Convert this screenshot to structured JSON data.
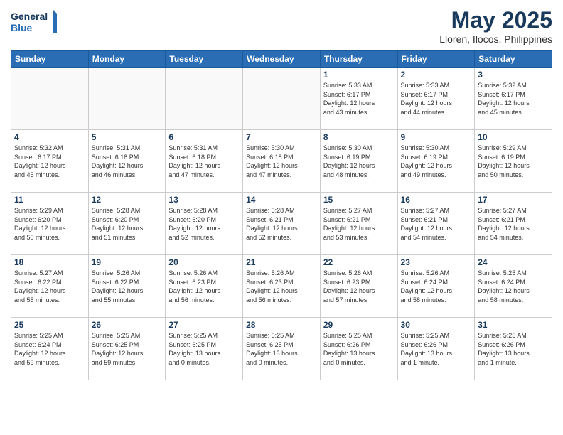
{
  "header": {
    "logo_line1": "General",
    "logo_line2": "Blue",
    "month": "May 2025",
    "location": "Lloren, Ilocos, Philippines"
  },
  "weekdays": [
    "Sunday",
    "Monday",
    "Tuesday",
    "Wednesday",
    "Thursday",
    "Friday",
    "Saturday"
  ],
  "weeks": [
    [
      {
        "day": "",
        "info": ""
      },
      {
        "day": "",
        "info": ""
      },
      {
        "day": "",
        "info": ""
      },
      {
        "day": "",
        "info": ""
      },
      {
        "day": "1",
        "info": "Sunrise: 5:33 AM\nSunset: 6:17 PM\nDaylight: 12 hours\nand 43 minutes."
      },
      {
        "day": "2",
        "info": "Sunrise: 5:33 AM\nSunset: 6:17 PM\nDaylight: 12 hours\nand 44 minutes."
      },
      {
        "day": "3",
        "info": "Sunrise: 5:32 AM\nSunset: 6:17 PM\nDaylight: 12 hours\nand 45 minutes."
      }
    ],
    [
      {
        "day": "4",
        "info": "Sunrise: 5:32 AM\nSunset: 6:17 PM\nDaylight: 12 hours\nand 45 minutes."
      },
      {
        "day": "5",
        "info": "Sunrise: 5:31 AM\nSunset: 6:18 PM\nDaylight: 12 hours\nand 46 minutes."
      },
      {
        "day": "6",
        "info": "Sunrise: 5:31 AM\nSunset: 6:18 PM\nDaylight: 12 hours\nand 47 minutes."
      },
      {
        "day": "7",
        "info": "Sunrise: 5:30 AM\nSunset: 6:18 PM\nDaylight: 12 hours\nand 47 minutes."
      },
      {
        "day": "8",
        "info": "Sunrise: 5:30 AM\nSunset: 6:19 PM\nDaylight: 12 hours\nand 48 minutes."
      },
      {
        "day": "9",
        "info": "Sunrise: 5:30 AM\nSunset: 6:19 PM\nDaylight: 12 hours\nand 49 minutes."
      },
      {
        "day": "10",
        "info": "Sunrise: 5:29 AM\nSunset: 6:19 PM\nDaylight: 12 hours\nand 50 minutes."
      }
    ],
    [
      {
        "day": "11",
        "info": "Sunrise: 5:29 AM\nSunset: 6:20 PM\nDaylight: 12 hours\nand 50 minutes."
      },
      {
        "day": "12",
        "info": "Sunrise: 5:28 AM\nSunset: 6:20 PM\nDaylight: 12 hours\nand 51 minutes."
      },
      {
        "day": "13",
        "info": "Sunrise: 5:28 AM\nSunset: 6:20 PM\nDaylight: 12 hours\nand 52 minutes."
      },
      {
        "day": "14",
        "info": "Sunrise: 5:28 AM\nSunset: 6:21 PM\nDaylight: 12 hours\nand 52 minutes."
      },
      {
        "day": "15",
        "info": "Sunrise: 5:27 AM\nSunset: 6:21 PM\nDaylight: 12 hours\nand 53 minutes."
      },
      {
        "day": "16",
        "info": "Sunrise: 5:27 AM\nSunset: 6:21 PM\nDaylight: 12 hours\nand 54 minutes."
      },
      {
        "day": "17",
        "info": "Sunrise: 5:27 AM\nSunset: 6:21 PM\nDaylight: 12 hours\nand 54 minutes."
      }
    ],
    [
      {
        "day": "18",
        "info": "Sunrise: 5:27 AM\nSunset: 6:22 PM\nDaylight: 12 hours\nand 55 minutes."
      },
      {
        "day": "19",
        "info": "Sunrise: 5:26 AM\nSunset: 6:22 PM\nDaylight: 12 hours\nand 55 minutes."
      },
      {
        "day": "20",
        "info": "Sunrise: 5:26 AM\nSunset: 6:23 PM\nDaylight: 12 hours\nand 56 minutes."
      },
      {
        "day": "21",
        "info": "Sunrise: 5:26 AM\nSunset: 6:23 PM\nDaylight: 12 hours\nand 56 minutes."
      },
      {
        "day": "22",
        "info": "Sunrise: 5:26 AM\nSunset: 6:23 PM\nDaylight: 12 hours\nand 57 minutes."
      },
      {
        "day": "23",
        "info": "Sunrise: 5:26 AM\nSunset: 6:24 PM\nDaylight: 12 hours\nand 58 minutes."
      },
      {
        "day": "24",
        "info": "Sunrise: 5:25 AM\nSunset: 6:24 PM\nDaylight: 12 hours\nand 58 minutes."
      }
    ],
    [
      {
        "day": "25",
        "info": "Sunrise: 5:25 AM\nSunset: 6:24 PM\nDaylight: 12 hours\nand 59 minutes."
      },
      {
        "day": "26",
        "info": "Sunrise: 5:25 AM\nSunset: 6:25 PM\nDaylight: 12 hours\nand 59 minutes."
      },
      {
        "day": "27",
        "info": "Sunrise: 5:25 AM\nSunset: 6:25 PM\nDaylight: 13 hours\nand 0 minutes."
      },
      {
        "day": "28",
        "info": "Sunrise: 5:25 AM\nSunset: 6:25 PM\nDaylight: 13 hours\nand 0 minutes."
      },
      {
        "day": "29",
        "info": "Sunrise: 5:25 AM\nSunset: 6:26 PM\nDaylight: 13 hours\nand 0 minutes."
      },
      {
        "day": "30",
        "info": "Sunrise: 5:25 AM\nSunset: 6:26 PM\nDaylight: 13 hours\nand 1 minute."
      },
      {
        "day": "31",
        "info": "Sunrise: 5:25 AM\nSunset: 6:26 PM\nDaylight: 13 hours\nand 1 minute."
      }
    ]
  ]
}
